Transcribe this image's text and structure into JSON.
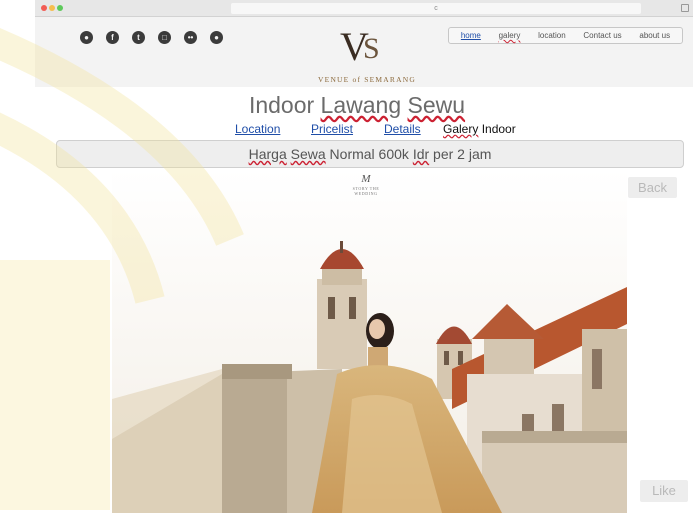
{
  "browser": {
    "url_text": "c"
  },
  "header": {
    "social_icons": [
      {
        "name": "website-icon",
        "glyph": "●"
      },
      {
        "name": "facebook-icon",
        "glyph": "f"
      },
      {
        "name": "twitter-icon",
        "glyph": "t"
      },
      {
        "name": "instagram-icon",
        "glyph": "□"
      },
      {
        "name": "flickr-icon",
        "glyph": "••"
      },
      {
        "name": "link-icon",
        "glyph": "●"
      }
    ],
    "logo": {
      "mark_v": "V",
      "mark_s": "S",
      "text": "VENUE of SEMARANG"
    },
    "nav": {
      "home": "home",
      "galery": "galery",
      "location": "location",
      "contact": "Contact us",
      "about": "about us"
    }
  },
  "main": {
    "title_word1": "Indoor",
    "title_word2": "Lawang",
    "title_word3": "Sewu",
    "tabs": {
      "location": "Location",
      "pricelist": "Pricelist",
      "details": "Details",
      "galery": "Galery",
      "indoor": "Indoor"
    },
    "price": {
      "w1": "Harga",
      "w2": "Sewa",
      "w3": "Normal 600k",
      "w4": "Idr",
      "w5": "per 2 jam"
    },
    "photo_logo": {
      "mark": "M",
      "text": "STORY THE WEDDING"
    },
    "back_button": "Back",
    "like_button": "Like"
  },
  "colors": {
    "accent_link": "#1f4ea8",
    "logo_brown": "#3a2c22",
    "logo_gold": "#8c6a3d",
    "watermark": "#f6e9a6"
  }
}
